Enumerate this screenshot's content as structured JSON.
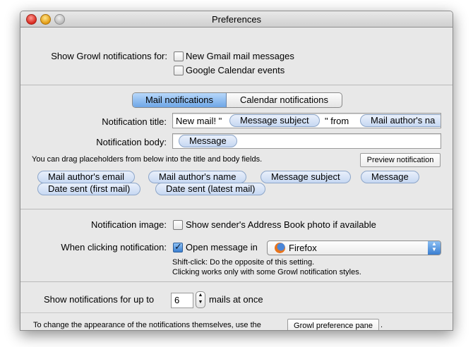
{
  "window": {
    "title": "Preferences"
  },
  "show_growl": {
    "label": "Show Growl notifications for:",
    "options": [
      {
        "label": "New Gmail mail messages",
        "checked": false
      },
      {
        "label": "Google Calendar events",
        "checked": false
      }
    ]
  },
  "tabs": [
    {
      "label": "Mail notifications",
      "selected": true
    },
    {
      "label": "Calendar notifications",
      "selected": false
    }
  ],
  "notification_title": {
    "label": "Notification title:",
    "text_before": "New mail! \"",
    "token_1": "Message subject",
    "text_middle": "\" from",
    "token_2": "Mail author's na"
  },
  "notification_body": {
    "label": "Notification body:",
    "token": "Message"
  },
  "drag_hint": "You can drag placeholders from below into the title and body fields.",
  "preview_button": "Preview notification",
  "placeholders": {
    "p1": "Mail author's email",
    "p2": "Mail author's name",
    "p3": "Message subject",
    "p4": "Message",
    "p5": "Date sent (first mail)",
    "p6": "Date sent (latest mail)"
  },
  "notification_image": {
    "label": "Notification image:",
    "checkbox_label": "Show sender's Address Book photo if available",
    "checked": false
  },
  "when_clicking": {
    "label": "When clicking notification:",
    "checkbox_label": "Open message in",
    "checked": true,
    "browser": "Firefox",
    "icon": "firefox-icon"
  },
  "shift_click_note_1": "Shift-click: Do the opposite of this setting.",
  "shift_click_note_2": "Clicking works only with some Growl notification styles.",
  "limit": {
    "before": "Show notifications for up to",
    "value": "6",
    "after": "mails at once"
  },
  "appearance": {
    "text": "To change the appearance of the notifications themselves, use the",
    "button": "Growl preference pane",
    "suffix": "."
  },
  "colors": {
    "selected_tab": "#6ea6e6",
    "pill_fill": "#c7d8f2",
    "checkbox_checked": "#3a7fd0"
  }
}
